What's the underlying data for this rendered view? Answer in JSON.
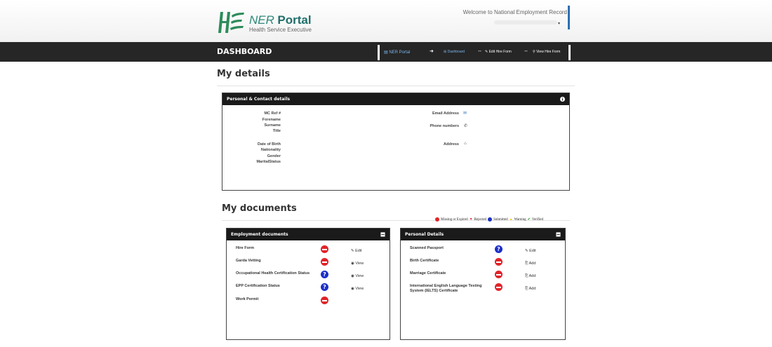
{
  "header": {
    "logo_ner": "NER",
    "logo_portal": "Portal",
    "logo_sub": "Health Service Executive",
    "welcome": "Welcome to National Employment Record"
  },
  "nav": {
    "title": "DASHBOARD",
    "crumbs": [
      "NER Portal",
      "Dashboard",
      "Edit Hire Form",
      "View Hire Form"
    ]
  },
  "my_details": {
    "title": "My details",
    "panel_title": "Personal & Contact details",
    "left_labels_1": [
      "MC Ref #",
      "Forename",
      "Surname",
      "Title"
    ],
    "left_labels_2": [
      "Date of Birth",
      "Nationality",
      "Gender",
      "MaritalStatus"
    ],
    "email_label": "Email Address",
    "phone_label": "Phone numbers",
    "address_label": "Address"
  },
  "my_documents": {
    "title": "My documents",
    "legend": {
      "missing": "Missing or Expired",
      "rejected": "Rejected",
      "submitted": "Submitted",
      "warning": "Warning",
      "verified": "Verified"
    },
    "employment": {
      "title": "Employment documents",
      "rows": [
        {
          "name": "Hire Form",
          "status": "missing",
          "action": "Edit"
        },
        {
          "name": "Garda Vetting",
          "status": "missing",
          "action": "View"
        },
        {
          "name": "Occupational Health Certification Status",
          "status": "submitted",
          "action": "View"
        },
        {
          "name": "EPP Certification Status",
          "status": "submitted",
          "action": "View"
        },
        {
          "name": "Work Permit",
          "status": "missing",
          "action": ""
        }
      ]
    },
    "personal": {
      "title": "Personal Details",
      "rows": [
        {
          "name": "Scanned Passport",
          "status": "submitted",
          "action": "Edit"
        },
        {
          "name": "Birth Certificate",
          "status": "missing",
          "action": "Add"
        },
        {
          "name": "Marriage Certificate",
          "status": "missing",
          "action": "Add"
        },
        {
          "name": "International English Language Testing System (IELTS) Certificate",
          "status": "missing",
          "action": "Add"
        }
      ]
    }
  },
  "colors": {
    "accent": "#2b6fb6",
    "navbar": "#262626",
    "missing": "#e0242a",
    "submitted": "#1b2fc8",
    "verified": "#2e9a2e",
    "warning": "#f1c40f"
  }
}
